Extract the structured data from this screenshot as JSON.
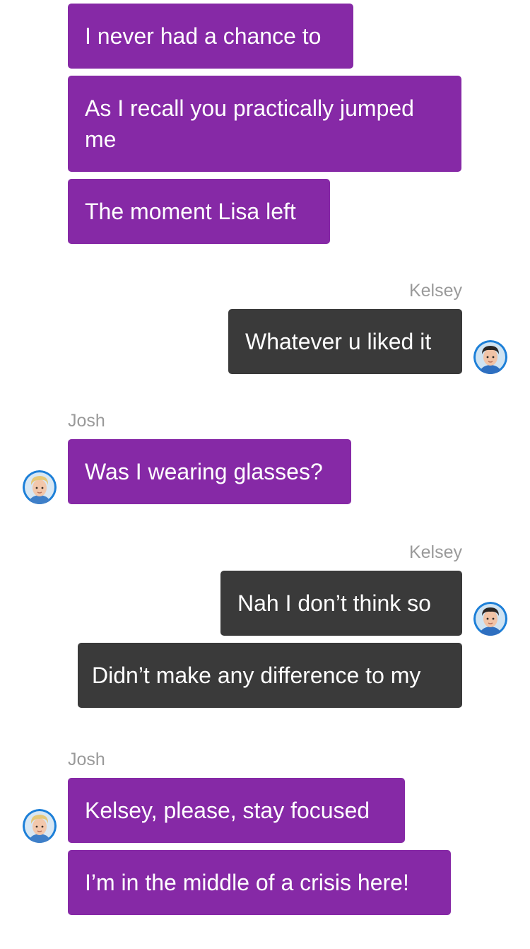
{
  "colors": {
    "incoming_bubble": "#8629a6",
    "outgoing_bubble": "#3a3a3a",
    "sender_label": "#9a9a9a",
    "avatar_ring": "#1c7fd8"
  },
  "messages": [
    {
      "sender": "Josh",
      "direction": "incoming",
      "text": "I never had a chance to"
    },
    {
      "sender": "Josh",
      "direction": "incoming",
      "text": "As I recall you practically jumped me"
    },
    {
      "sender": "Josh",
      "direction": "incoming",
      "text": "The moment Lisa left"
    },
    {
      "sender": "Kelsey",
      "direction": "outgoing",
      "text": "Whatever u liked it"
    },
    {
      "sender": "Josh",
      "direction": "incoming",
      "text": "Was I wearing glasses?"
    },
    {
      "sender": "Kelsey",
      "direction": "outgoing",
      "text": "Nah I don’t think so"
    },
    {
      "sender": "Kelsey",
      "direction": "outgoing",
      "text": "Didn’t make any difference to my"
    },
    {
      "sender": "Josh",
      "direction": "incoming",
      "text": "Kelsey, please, stay focused"
    },
    {
      "sender": "Josh",
      "direction": "incoming",
      "text": "I’m in the middle of a crisis here!"
    }
  ],
  "sender_labels": {
    "kelsey_1": "Kelsey",
    "josh_1": "Josh",
    "kelsey_2": "Kelsey",
    "josh_2": "Josh"
  },
  "avatars": {
    "kelsey": "kelsey-avatar (dark-haired man, blue ring)",
    "josh": "josh-avatar (blond man, blue ring)"
  }
}
